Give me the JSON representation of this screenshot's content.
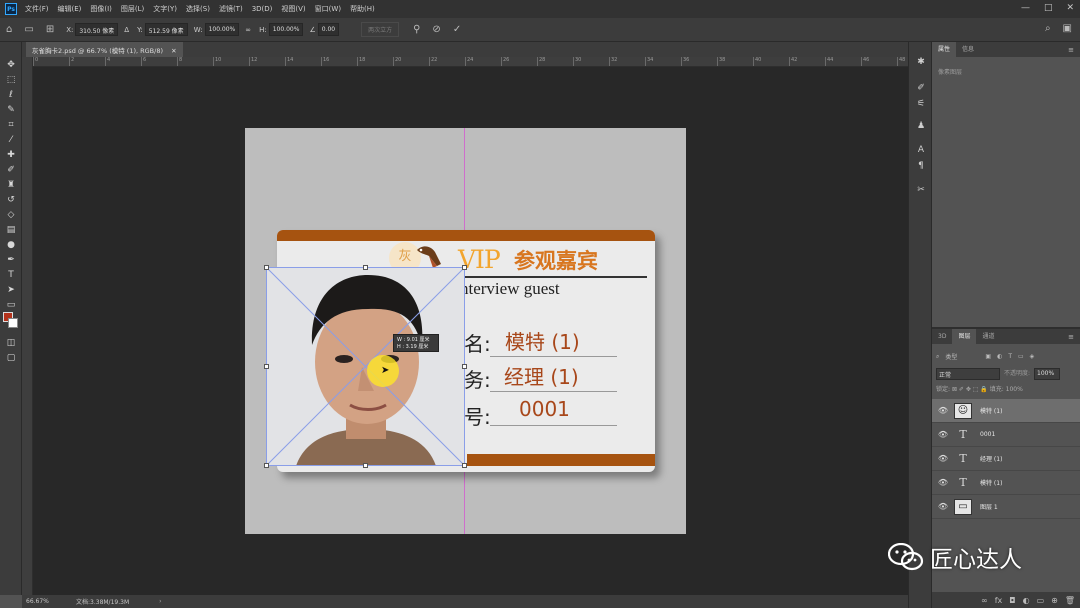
{
  "app": {
    "logo": "Ps"
  },
  "menu": [
    "文件(F)",
    "编辑(E)",
    "图像(I)",
    "图层(L)",
    "文字(Y)",
    "选择(S)",
    "滤镜(T)",
    "3D(D)",
    "视图(V)",
    "窗口(W)",
    "帮助(H)"
  ],
  "window_controls": {
    "minimize": "—",
    "maximize": "□",
    "close": "✕"
  },
  "options": {
    "x_label": "X:",
    "x_value": "310.50 像素",
    "y_label": "Y:",
    "y_value": "512.59 像素",
    "w_label": "W:",
    "w_value": "100.00%",
    "h_label": "H:",
    "h_value": "100.00%",
    "angle_value": "0.00",
    "interp_button": "两次立方",
    "cancel_icon": "⊘",
    "commit_icon": "✓"
  },
  "document": {
    "tab_title": "灰雀胸卡2.psd @ 66.7% (模特 (1), RGB/8)",
    "tab_close": "✕",
    "ruler_ticks": [
      "0",
      "2",
      "4",
      "6",
      "8",
      "10",
      "12",
      "14",
      "16",
      "18",
      "20",
      "22",
      "24",
      "26",
      "28",
      "30",
      "32",
      "34",
      "36",
      "38",
      "40",
      "42",
      "44",
      "46",
      "48"
    ]
  },
  "card": {
    "logo_char": "灰",
    "title": "VIP",
    "title_cn": "参观嘉宾",
    "subtitle": "nterview guest",
    "label_name": "名:",
    "label_post": "务:",
    "label_no": "号:",
    "value_name": "模特 (1)",
    "value_post": "经理 (1)",
    "value_no": "0001"
  },
  "transform_tip": {
    "w": "W : 9.01 厘米",
    "h": "H : 3.19 厘米"
  },
  "status": {
    "zoom": "66.67%",
    "doc": "文档:3.38M/19.3M"
  },
  "properties_panel": {
    "tab_properties": "属性",
    "tab_info": "信息",
    "sub": "像素图层"
  },
  "layers_panel": {
    "tab_3d": "3D",
    "tab_layers": "图层",
    "tab_channels": "通道",
    "search": "类型",
    "blend_mode": "正常",
    "opacity_label": "不透明度:",
    "opacity_value": "100%",
    "lock_label": "锁定:",
    "fill_label": "填充:",
    "fill_value": "100%",
    "layers": [
      {
        "name": "模特 (1)",
        "type": "image",
        "selected": true
      },
      {
        "name": "0001",
        "type": "text",
        "selected": false
      },
      {
        "name": "经理 (1)",
        "type": "text",
        "selected": false
      },
      {
        "name": "模特 (1)",
        "type": "text",
        "selected": false
      },
      {
        "name": "图层 1",
        "type": "image",
        "selected": false
      }
    ]
  },
  "watermark": {
    "text": "匠心达人"
  },
  "colors": {
    "foreground": "#b4321b",
    "background": "#ffffff",
    "card_accent": "#a65310",
    "vip_orange": "#f2a52e",
    "value_red": "#a8471a"
  }
}
